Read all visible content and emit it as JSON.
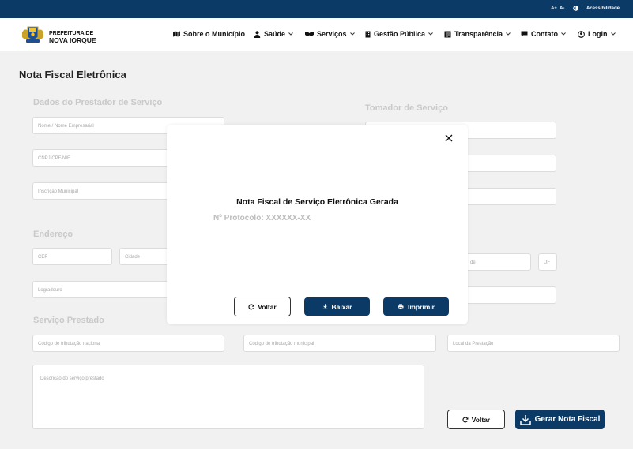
{
  "topbar": {
    "font_increase": "A+",
    "font_decrease": "A-",
    "accessibility": "Acessibilidade"
  },
  "brand": {
    "line1": "PREFEITURA DE",
    "line2": "NOVA IORQUE"
  },
  "nav": {
    "about": "Sobre o Município",
    "health": "Saúde",
    "services": "Serviços",
    "public_management": "Gestão Pública",
    "transparency": "Transparência",
    "contact": "Contato",
    "login": "Login"
  },
  "page": {
    "title": "Nota Fiscal Eletrônica"
  },
  "provider": {
    "title": "Dados do Prestador de Serviço",
    "name_placeholder": "Nome / Nome Empresarial",
    "doc_placeholder": "CNPJ/CPF/NIF",
    "municipal_reg_placeholder": "Inscrição Municipal"
  },
  "taker": {
    "title": "Tomador de Serviço"
  },
  "address": {
    "title": "Endereço",
    "cep_placeholder": "CEP",
    "city_placeholder": "Cidade",
    "street_placeholder": "Logradouro",
    "taker_city_placeholder": "de",
    "uf_placeholder": "UF"
  },
  "service": {
    "title": "Serviço Prestado",
    "national_code_placeholder": "Código de tributação nacional",
    "municipal_code_placeholder": "Código de tributação municipal",
    "location_placeholder": "Local da Prestação",
    "description_placeholder": "Descrição do serviço prestado"
  },
  "actions": {
    "back": "Voltar",
    "generate": "Gerar Nota Fiscal"
  },
  "modal": {
    "title": "Nota Fiscal de Serviço Eletrônica Gerada",
    "protocol": "Nº Protocolo: XXXXXX-XX",
    "back": "Voltar",
    "download": "Baixar",
    "print": "Imprimir"
  },
  "colors": {
    "primary": "#0b3a66",
    "background": "#f1f1f1",
    "muted_text": "#c9c9c9"
  }
}
